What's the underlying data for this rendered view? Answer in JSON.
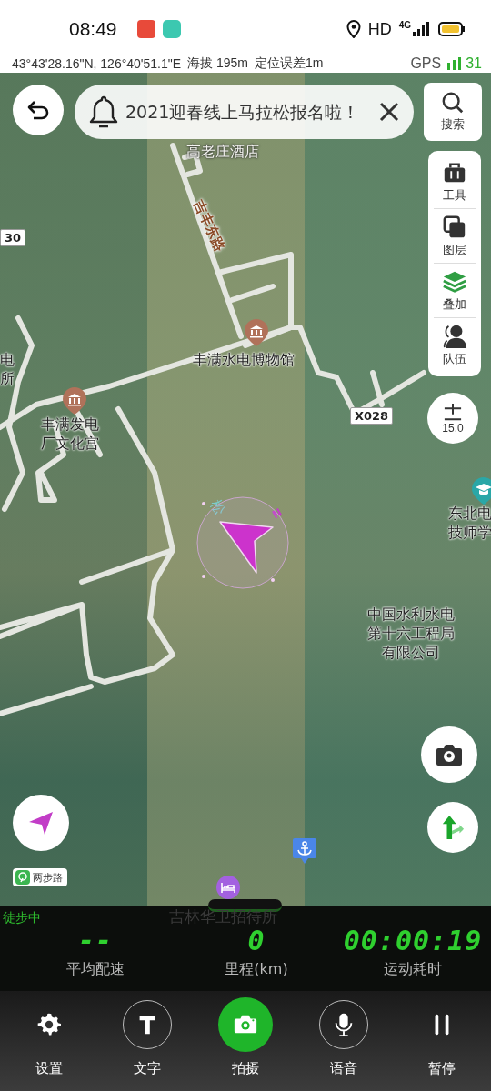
{
  "status_bar": {
    "time": "08:49",
    "hd": "HD",
    "network": "4G"
  },
  "location_bar": {
    "coordinates": "43°43'28.16\"N,  126°40'51.1\"E",
    "altitude": "海拔 195m",
    "accuracy": "定位误差1m",
    "gps_label": "GPS",
    "satellites": "31"
  },
  "banner": {
    "text": "2021迎春线上马拉松报名啦！"
  },
  "search_button": {
    "label": "搜索"
  },
  "side_tools": [
    {
      "kind": "tools",
      "label": "工具"
    },
    {
      "kind": "layers",
      "label": "图层"
    },
    {
      "kind": "overlay",
      "label": "叠加"
    },
    {
      "kind": "team",
      "label": "队伍"
    }
  ],
  "zoom_control": {
    "label": "15.0"
  },
  "map_labels": [
    {
      "kind": "faint",
      "lines": [
        "高老庄酒店"
      ]
    },
    {
      "kind": "plate",
      "lines": [
        "30"
      ]
    },
    {
      "kind": "road",
      "lines": [
        "吉丰东路"
      ]
    },
    {
      "kind": "plain",
      "lines": [
        "电",
        "所"
      ]
    },
    {
      "kind": "plain",
      "lines": [
        "丰满水电博物馆"
      ]
    },
    {
      "kind": "plain",
      "lines": [
        "丰满发电",
        "厂文化宫"
      ]
    },
    {
      "kind": "plate",
      "lines": [
        "X028"
      ]
    },
    {
      "kind": "plain",
      "lines": [
        "东北电",
        "技师学"
      ]
    },
    {
      "kind": "cyan",
      "lines": [
        "松"
      ]
    },
    {
      "kind": "compass",
      "lines": [
        "N"
      ]
    },
    {
      "kind": "plain",
      "lines": [
        "中国水利水电",
        "第十六工程局",
        "有限公司"
      ]
    }
  ],
  "map_markers": [
    {
      "kind": "museum"
    },
    {
      "kind": "museum"
    },
    {
      "kind": "school"
    },
    {
      "kind": "anchor"
    },
    {
      "kind": "hotel"
    }
  ],
  "route_tag": {
    "label": "两步路"
  },
  "stats": {
    "status": "徒步中",
    "hidden_label": "吉林华卫招待所",
    "metrics": [
      {
        "value": "--",
        "label": "平均配速"
      },
      {
        "value": "0",
        "label": "里程(km)"
      },
      {
        "value": "00:00:19",
        "label": "运动耗时"
      }
    ]
  },
  "toolbar": [
    {
      "kind": "settings",
      "label": "设置"
    },
    {
      "kind": "text",
      "label": "文字"
    },
    {
      "kind": "camera",
      "label": "拍摄"
    },
    {
      "kind": "voice",
      "label": "语音"
    },
    {
      "kind": "pause",
      "label": "暂停"
    }
  ]
}
